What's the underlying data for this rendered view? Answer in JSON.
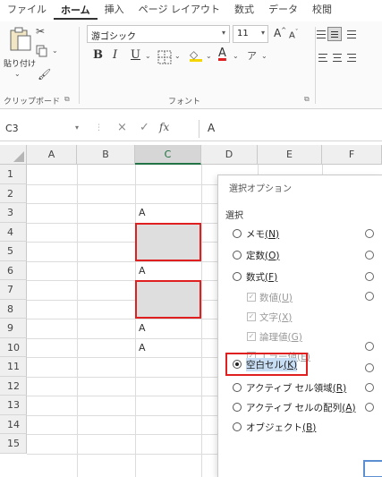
{
  "ribbon_tabs": [
    "ファイル",
    "ホーム",
    "挿入",
    "ページ レイアウト",
    "数式",
    "データ",
    "校閲"
  ],
  "active_tab_index": 1,
  "clipboard": {
    "paste_label": "貼り付け",
    "group_label": "クリップボード"
  },
  "font": {
    "name": "游ゴシック",
    "size": "11",
    "bold": "B",
    "italic": "I",
    "underline": "U",
    "grow": "A",
    "shrink": "A",
    "fill_glyph": "◇",
    "color_glyph": "A",
    "phonetic_glyph": "ア",
    "group_label": "フォント"
  },
  "formula_bar": {
    "name_box": "C3",
    "dots": "⋮",
    "cancel": "×",
    "enter": "✓",
    "fx": "fx",
    "content": "A"
  },
  "grid": {
    "columns": [
      "A",
      "B",
      "C",
      "D",
      "E",
      "F"
    ],
    "selected_column": "C",
    "rows": [
      "1",
      "2",
      "3",
      "4",
      "5",
      "6",
      "7",
      "8",
      "9",
      "10",
      "11",
      "12",
      "13",
      "14",
      "15"
    ],
    "cells": [
      {
        "ref": "C3",
        "value": "A"
      },
      {
        "ref": "C6",
        "value": "A"
      },
      {
        "ref": "C9",
        "value": "A"
      },
      {
        "ref": "C10",
        "value": "A"
      }
    ],
    "highlighted_blank_ranges": [
      "C4:C5",
      "C7:C8"
    ]
  },
  "dialog": {
    "title": "選択オプション",
    "section": "選択",
    "options": [
      {
        "label": "メモ",
        "key": "N",
        "checked": false
      },
      {
        "label": "定数",
        "key": "O",
        "checked": false
      },
      {
        "label": "数式",
        "key": "F",
        "checked": false
      }
    ],
    "sub_options": [
      {
        "label": "数値",
        "key": "U"
      },
      {
        "label": "文字",
        "key": "X"
      },
      {
        "label": "論理値",
        "key": "G"
      },
      {
        "label": "エラー値",
        "key": "E"
      }
    ],
    "blank_option": {
      "label": "空白セル",
      "key": "K",
      "checked": true
    },
    "more_options": [
      {
        "label": "アクティブ セル領域",
        "key": "R",
        "checked": false
      },
      {
        "label": "アクティブ セルの配列",
        "key": "A",
        "checked": false
      },
      {
        "label": "オブジェクト",
        "key": "B",
        "checked": false
      }
    ]
  },
  "colors": {
    "highlight": "#e02020",
    "selection_fill": "#dedede",
    "excel_green": "#217346"
  }
}
